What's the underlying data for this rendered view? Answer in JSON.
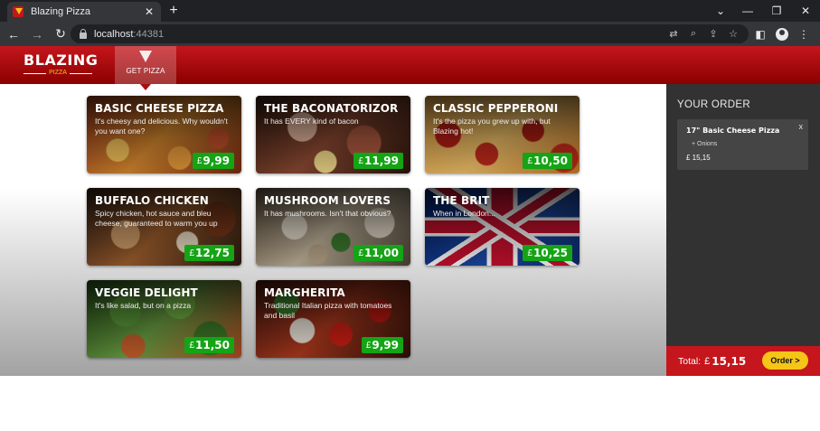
{
  "browser": {
    "tab_title": "Blazing Pizza",
    "tab_close": "✕",
    "new_tab": "+",
    "url_host": "localhost",
    "url_port": ":44381",
    "window_controls": [
      "⌄",
      "—",
      "❐",
      "✕"
    ]
  },
  "header": {
    "logo_main": "BLAZING",
    "logo_sub": "PIZZA",
    "nav_get_pizza": "GET PIZZA"
  },
  "specials": [
    {
      "name": "BASIC CHEESE PIZZA",
      "description": "It's cheesy and delicious. Why wouldn't you want one?",
      "currency": "£",
      "price": "9,99",
      "image": "bg-cheese"
    },
    {
      "name": "THE BACONATORIZOR",
      "description": "It has EVERY kind of bacon",
      "currency": "£",
      "price": "11,99",
      "image": "bg-bacon"
    },
    {
      "name": "CLASSIC PEPPERONI",
      "description": "It's the pizza you grew up with, but Blazing hot!",
      "currency": "£",
      "price": "10,50",
      "image": "bg-pepperoni"
    },
    {
      "name": "BUFFALO CHICKEN",
      "description": "Spicy chicken, hot sauce and bleu cheese, guaranteed to warm you up",
      "currency": "£",
      "price": "12,75",
      "image": "bg-buffalo"
    },
    {
      "name": "MUSHROOM LOVERS",
      "description": "It has mushrooms. Isn't that obvious?",
      "currency": "£",
      "price": "11,00",
      "image": "bg-mushroom"
    },
    {
      "name": "THE BRIT",
      "description": "When in London...",
      "currency": "£",
      "price": "10,25",
      "image": "bg-brit"
    },
    {
      "name": "VEGGIE DELIGHT",
      "description": "It's like salad, but on a pizza",
      "currency": "£",
      "price": "11,50",
      "image": "bg-veggie"
    },
    {
      "name": "MARGHERITA",
      "description": "Traditional Italian pizza with tomatoes and basil",
      "currency": "£",
      "price": "9,99",
      "image": "bg-margherita"
    }
  ],
  "order": {
    "title": "YOUR ORDER",
    "items": [
      {
        "name": "17\" Basic Cheese Pizza",
        "toppings": [
          "+ Onions"
        ],
        "price": "£ 15,15",
        "remove": "x"
      }
    ],
    "total_label": "Total:",
    "total_currency": "£",
    "total_value": "15,15",
    "order_button": "Order >"
  }
}
